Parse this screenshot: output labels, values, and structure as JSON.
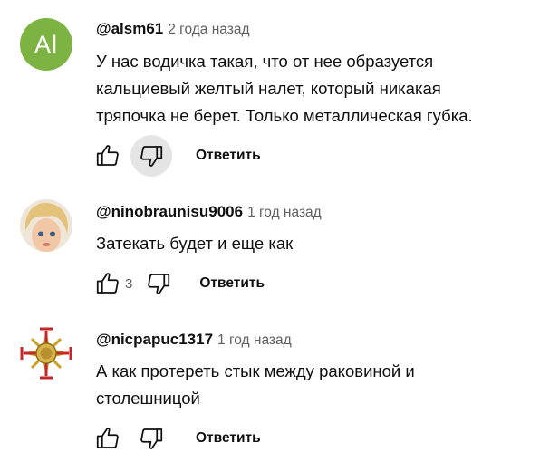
{
  "comments": [
    {
      "avatar_letters": "Al",
      "author": "@alsm61",
      "time": "2 года назад",
      "text_lines": [
        "У нас водичка такая, что от нее образуется",
        "кальциевый желтый налет, который никакая",
        "тряпочка не берет. Только металлическая губка."
      ],
      "likes": "",
      "reply_label": "Ответить",
      "dislike_pressed": true
    },
    {
      "avatar_letters": "",
      "author": "@ninobraunisu9006",
      "time": "1 год назад",
      "text_lines": [
        "Затекать будет и еще как"
      ],
      "likes": "3",
      "reply_label": "Ответить",
      "dislike_pressed": false
    },
    {
      "avatar_letters": "",
      "author": "@nicpapuc1317",
      "time": "1 год назад",
      "text_lines": [
        "А как протереть стык между раковиной и",
        "столешницой"
      ],
      "likes": "",
      "reply_label": "Ответить",
      "dislike_pressed": false
    }
  ],
  "colors": {
    "avatar_green": "#7cb342",
    "pressed_bg": "#e5e5e5",
    "meta_gray": "#606060",
    "emblem_red": "#c62828",
    "emblem_gold": "#c9a227"
  }
}
